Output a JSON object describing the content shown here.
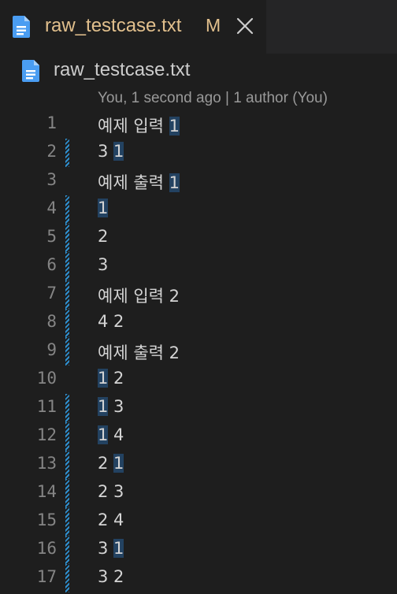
{
  "tab": {
    "title": "raw_testcase.txt",
    "status": "M",
    "icon": "file-text-icon",
    "close_icon": "close-icon"
  },
  "breadcrumb": {
    "label": "raw_testcase.txt",
    "icon": "file-text-icon"
  },
  "codelens": "You, 1 second ago | 1 author (You)",
  "colors": {
    "background": "#1e1e1e",
    "tab_text_modified": "#e2c08d",
    "file_icon": "#4a9df2",
    "gutter_modified": "#2e8fcf",
    "line_number": "#858585",
    "highlight": "#264f78"
  },
  "lines": [
    {
      "num": "1",
      "pre": "예제 입력 ",
      "hl": "1",
      "post": ""
    },
    {
      "num": "2",
      "pre": "3 ",
      "hl": "1",
      "post": ""
    },
    {
      "num": "3",
      "pre": "예제 출력 ",
      "hl": "1",
      "post": ""
    },
    {
      "num": "4",
      "pre": "",
      "hl": "1",
      "post": ""
    },
    {
      "num": "5",
      "pre": "2",
      "hl": "",
      "post": ""
    },
    {
      "num": "6",
      "pre": "3",
      "hl": "",
      "post": ""
    },
    {
      "num": "7",
      "pre": "예제 입력 2",
      "hl": "",
      "post": ""
    },
    {
      "num": "8",
      "pre": "4 2",
      "hl": "",
      "post": ""
    },
    {
      "num": "9",
      "pre": "예제 출력 2",
      "hl": "",
      "post": ""
    },
    {
      "num": "10",
      "pre": "",
      "hl": "1",
      "post": " 2"
    },
    {
      "num": "11",
      "pre": "",
      "hl": "1",
      "post": " 3"
    },
    {
      "num": "12",
      "pre": "",
      "hl": "1",
      "post": " 4"
    },
    {
      "num": "13",
      "pre": "2 ",
      "hl": "1",
      "post": ""
    },
    {
      "num": "14",
      "pre": "2 3",
      "hl": "",
      "post": ""
    },
    {
      "num": "15",
      "pre": "2 4",
      "hl": "",
      "post": ""
    },
    {
      "num": "16",
      "pre": "3 ",
      "hl": "1",
      "post": ""
    },
    {
      "num": "17",
      "pre": "3 2",
      "hl": "",
      "post": ""
    }
  ],
  "modified_lines": [
    "2",
    "4",
    "5",
    "6",
    "7",
    "8",
    "9",
    "11",
    "12",
    "13",
    "14",
    "15",
    "16",
    "17"
  ]
}
